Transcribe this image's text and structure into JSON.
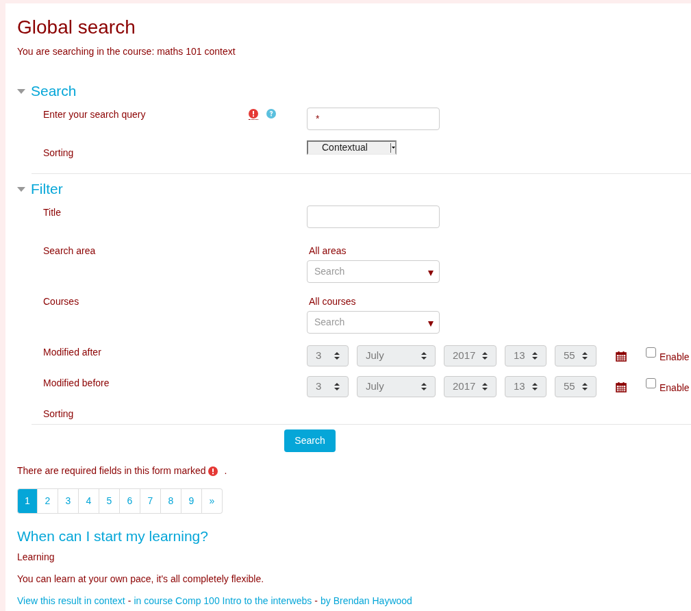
{
  "title": "Global search",
  "context_note": "You are searching in the course: maths 101 context",
  "sections": [
    {
      "heading": "Search",
      "expanded": true,
      "rows": [
        {
          "kind": "text",
          "label": "Enter your search query",
          "required": true,
          "help": true,
          "value": "*"
        },
        {
          "kind": "select",
          "label": "Sorting",
          "value": "Contextual"
        }
      ]
    },
    {
      "heading": "Filter",
      "expanded": true,
      "rows": [
        {
          "kind": "text",
          "label": "Title",
          "required": false,
          "help": false,
          "value": ""
        },
        {
          "kind": "autocomplete",
          "label": "Search area",
          "selection": "All areas",
          "placeholder": "Search"
        },
        {
          "kind": "autocomplete",
          "label": "Courses",
          "selection": "All courses",
          "placeholder": "Search"
        },
        {
          "kind": "datetime",
          "label": "Modified after",
          "day": "3",
          "month": "July",
          "year": "2017",
          "hour": "13",
          "minute": "55",
          "enable_label": "Enable",
          "checked": false
        },
        {
          "kind": "datetime",
          "label": "Modified before",
          "day": "3",
          "month": "July",
          "year": "2017",
          "hour": "13",
          "minute": "55",
          "enable_label": "Enable",
          "checked": false
        },
        {
          "kind": "empty",
          "label": "Sorting"
        }
      ]
    }
  ],
  "submit": "Search",
  "required_note": {
    "before": "There are required fields in this form marked",
    "after": "."
  },
  "pagination": [
    {
      "label": "1",
      "selected": true
    },
    {
      "label": "2",
      "selected": false
    },
    {
      "label": "3",
      "selected": false
    },
    {
      "label": "4",
      "selected": false
    },
    {
      "label": "5",
      "selected": false
    },
    {
      "label": "6",
      "selected": false
    },
    {
      "label": "7",
      "selected": false
    },
    {
      "label": "8",
      "selected": false
    },
    {
      "label": "9",
      "selected": false
    },
    {
      "label": "»",
      "selected": false
    }
  ],
  "result": {
    "heading": "When can I start my learning?",
    "type_label": "Learning",
    "description": "You can learn at your own pace, it's all completely flexible.",
    "links": [
      "View this result in context",
      "in course Comp 100 Intro to the interwebs",
      "by Brendan Haywood"
    ],
    "separator": "-"
  }
}
